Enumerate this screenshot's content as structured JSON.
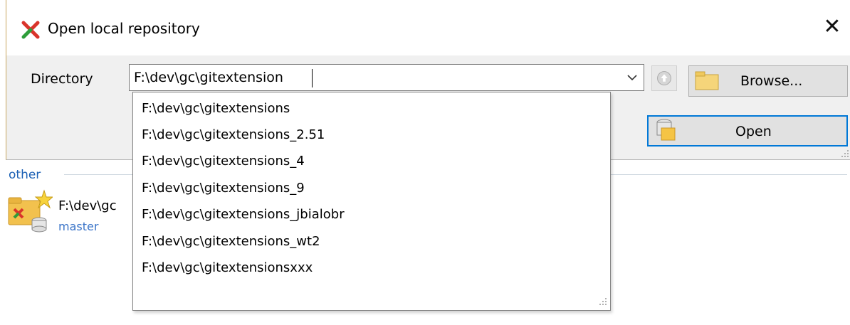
{
  "background": {
    "group_label": "other",
    "repo": {
      "path": "F:\\dev\\gc",
      "branch": "master"
    }
  },
  "dialog": {
    "title": "Open local repository",
    "close_symbol": "✕",
    "directory_label": "Directory",
    "directory_value": "F:\\dev\\gc\\gitextension",
    "browse_label": "Browse...",
    "open_label": "Open"
  },
  "suggestions": [
    "F:\\dev\\gc\\gitextensions",
    "F:\\dev\\gc\\gitextensions_2.51",
    "F:\\dev\\gc\\gitextensions_4",
    "F:\\dev\\gc\\gitextensions_9",
    "F:\\dev\\gc\\gitextensions_jbialobr",
    "F:\\dev\\gc\\gitextensions_wt2",
    "F:\\dev\\gc\\gitextensionsxxx"
  ],
  "icons": {
    "app": "git-extensions-icon",
    "dropdown": "chevron-down-icon",
    "up": "folder-up-icon",
    "browse": "folder-icon",
    "open": "open-repository-icon",
    "repo": "repository-folder-star-icon"
  },
  "colors": {
    "accent": "#0078d7",
    "group_label": "#1a5fb4",
    "branch": "#3a74c8",
    "app_icon_red": "#d9342b",
    "app_icon_green": "#2e9e3a"
  }
}
